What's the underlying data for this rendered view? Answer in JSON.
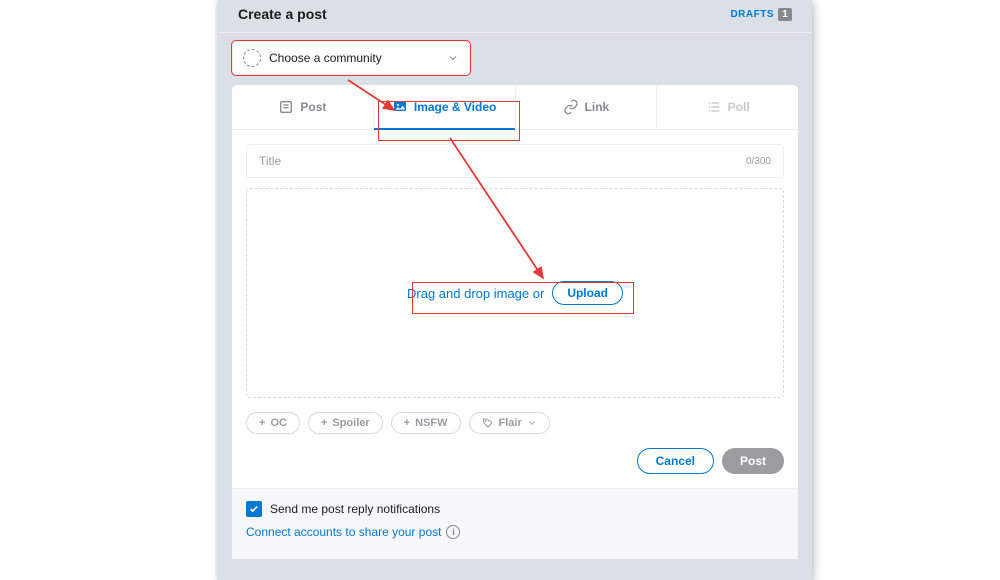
{
  "header": {
    "title": "Create a post",
    "drafts_label": "DRAFTS",
    "drafts_count": "1"
  },
  "community": {
    "placeholder": "Choose a community"
  },
  "tabs": {
    "post": "Post",
    "image": "Image & Video",
    "link": "Link",
    "poll": "Poll"
  },
  "title_field": {
    "placeholder": "Title",
    "count": "0/300"
  },
  "dropzone": {
    "text": "Drag and drop image or",
    "upload": "Upload"
  },
  "tags": {
    "oc": "OC",
    "spoiler": "Spoiler",
    "nsfw": "NSFW",
    "flair": "Flair"
  },
  "actions": {
    "cancel": "Cancel",
    "post": "Post"
  },
  "footer": {
    "notify": "Send me post reply notifications",
    "connect": "Connect accounts to share your post"
  }
}
